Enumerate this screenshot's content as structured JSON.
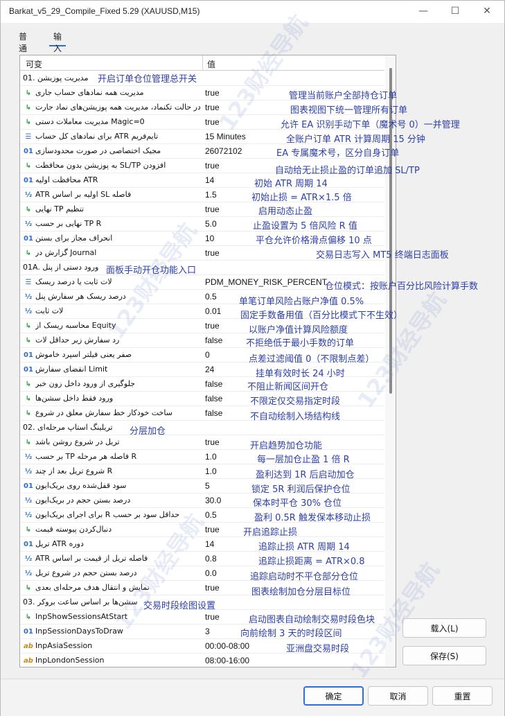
{
  "window": {
    "title": "Barkat_v5_29_Compile_Fixed 5.29 (XAUUSD,M15)",
    "minimize": "—",
    "maximize": "☐",
    "close": "✕"
  },
  "tabs": [
    {
      "label": "普通",
      "active": false
    },
    {
      "label": "输入",
      "active": true
    }
  ],
  "grid": {
    "header_variable": "可变",
    "header_value": "值"
  },
  "rows": [
    {
      "type": "group",
      "name": "01. مدیریت پوزیشن",
      "value": ""
    },
    {
      "type": "bool",
      "name": "مدیریت همه نمادهای حساب جاری",
      "value": "true"
    },
    {
      "type": "bool",
      "name": "در حالت تکنماد، مدیریت همه پوزیشن‌های نماد جارت",
      "value": "true"
    },
    {
      "type": "bool",
      "name": "مدیریت معاملات دستی Magic=0",
      "value": "true"
    },
    {
      "type": "enum",
      "name": "برای نمادهای کل حساب ATR تایم‌فریم",
      "value": "15 Minutes"
    },
    {
      "type": "int",
      "name": "مجیک اختصاصی در صورت محدودسازی",
      "value": "26072102"
    },
    {
      "type": "bool",
      "name": "به پوزیشن بدون محافظت SL/TP افزودن",
      "value": "true"
    },
    {
      "type": "int",
      "name": "محافظت اولیه ATR",
      "value": "14"
    },
    {
      "type": "dbl",
      "name": "ATR اولیه بر اساس SL فاصله",
      "value": "1.5"
    },
    {
      "type": "bool",
      "name": "نهایی TP تنظیم",
      "value": "true"
    },
    {
      "type": "dbl",
      "name": "نهایی بر حسب TP R",
      "value": "5.0"
    },
    {
      "type": "int",
      "name": "انحراف مجاز برای بستن",
      "value": "10"
    },
    {
      "type": "bool",
      "name": "گزارش در Journal",
      "value": "true"
    },
    {
      "type": "group",
      "name": "01A. ورود دستی از پنل",
      "value": ""
    },
    {
      "type": "enum",
      "name": "لات ثابت یا درصد ریسک",
      "value": "PDM_MONEY_RISK_PERCENT"
    },
    {
      "type": "dbl",
      "name": "درصد ریسک هر سفارش پنل",
      "value": "0.5"
    },
    {
      "type": "dbl",
      "name": "لات ثابت",
      "value": "0.01"
    },
    {
      "type": "bool",
      "name": "محاسبه ریسک از Equity",
      "value": "true"
    },
    {
      "type": "bool",
      "name": "رد سفارش زیر حداقل لات",
      "value": "false"
    },
    {
      "type": "int",
      "name": "صفر یعنی فیلتر اسپرد خاموش",
      "value": "0"
    },
    {
      "type": "int",
      "name": "انقضای سفارش Limit",
      "value": "24"
    },
    {
      "type": "bool",
      "name": "جلوگیری از ورود داخل زون خبر",
      "value": "false"
    },
    {
      "type": "bool",
      "name": "ورود فقط داخل سشن‌ها",
      "value": "false"
    },
    {
      "type": "bool",
      "name": "ساخت خودکار خط سفارش معلق در شروع",
      "value": "false"
    },
    {
      "type": "group",
      "name": "02. تریلینگ استاپ مرحله‌ای",
      "value": ""
    },
    {
      "type": "bool",
      "name": "تریل در شروع روشن باشد",
      "value": "true"
    },
    {
      "type": "dbl",
      "name": "بر حسب TP فاصله هر مرحله R",
      "value": "1.0"
    },
    {
      "type": "dbl",
      "name": "شروع تریل بعد از چند R",
      "value": "1.0"
    },
    {
      "type": "int",
      "name": "سود قفل‌شده روی بریک‌ایون",
      "value": "5"
    },
    {
      "type": "dbl",
      "name": "درصد بستن حجم در بریک‌ایون",
      "value": "30.0"
    },
    {
      "type": "dbl",
      "name": "برای اجرای بریک‌ایون R حداقل سود بر حسب",
      "value": "0.5"
    },
    {
      "type": "bool",
      "name": "دنبال‌کردن پیوسته قیمت",
      "value": "true"
    },
    {
      "type": "int",
      "name": "تریل ATR دوره",
      "value": "14"
    },
    {
      "type": "dbl",
      "name": "ATR فاصله تریل از قیمت بر اساس",
      "value": "0.8"
    },
    {
      "type": "dbl",
      "name": "درصد بستن حجم در شروع تریل",
      "value": "0.0"
    },
    {
      "type": "bool",
      "name": "نمایش و انتقال هدف مرحله‌ای بعدی",
      "value": "true"
    },
    {
      "type": "group",
      "name": "03. سشن‌ها بر اساس ساعت بروکر",
      "value": ""
    },
    {
      "type": "bool",
      "name": "InpShowSessionsAtStart",
      "value": "true"
    },
    {
      "type": "int",
      "name": "InpSessionDaysToDraw",
      "value": "3"
    },
    {
      "type": "str",
      "name": "InpAsiaSession",
      "value": "00:00-08:00"
    },
    {
      "type": "str",
      "name": "InpLondonSession",
      "value": "08:00-16:00"
    }
  ],
  "icons": {
    "bool": "↳",
    "int": "01",
    "dbl": "½",
    "enum": "☰",
    "str": "ab"
  },
  "notes": [
    "开启订单仓位管理总开关",
    "管理当前账户全部持仓订单",
    "图表视图下统一管理所有订单",
    "允许 EA 识别手动下单（魔术号 0）一并管理",
    "全账户订单 ATR 计算周期 15 分钟",
    "EA 专属魔术号，区分自身订单",
    "自动给无止损止盈的订单追加 SL/TP",
    "初始 ATR 周期 14",
    "初始止损 = ATR×1.5 倍",
    "启用动态止盈",
    "止盈设置为 5 倍风险 R 值",
    "平仓允许价格滑点偏移 10 点",
    "交易日志写入 MT5 终端日志面板",
    "面板手动开仓功能入口",
    "仓位模式：按账户百分比风险计算手数",
    "单笔订单风险占账户净值 0.5%",
    "固定手数备用值（百分比模式下不生效）",
    "以账户净值计算风险额度",
    "不拒绝低于最小手数的订单",
    "点差过滤阈值 0（不限制点差）",
    "挂单有效时长 24 小时",
    "不阻止新闻区间开仓",
    "不限定仅交易指定时段",
    "不自动绘制入场结构线",
    "分层加仓",
    "开启趋势加仓功能",
    "每一层加仓止盈 1 倍 R",
    "盈利达到 1R 后启动加仓",
    "锁定 5R 利润后保护仓位",
    "保本时平仓 30% 仓位",
    "盈利 0.5R 触发保本移动止损",
    "开启追踪止损",
    "追踪止损 ATR 周期 14",
    "追踪止损距离 = ATR×0.8",
    "追踪启动时不平仓部分仓位",
    "图表绘制加仓分层目标位",
    "交易时段绘图设置",
    "启动图表自动绘制交易时段色块",
    "向前绘制 3 天的时段区间",
    "亚洲盘交易时段"
  ],
  "buttons": {
    "load": "载入(L)",
    "save": "保存(S)",
    "ok": "确定",
    "cancel": "取消",
    "reset": "重置"
  },
  "watermark": "123财经导航"
}
